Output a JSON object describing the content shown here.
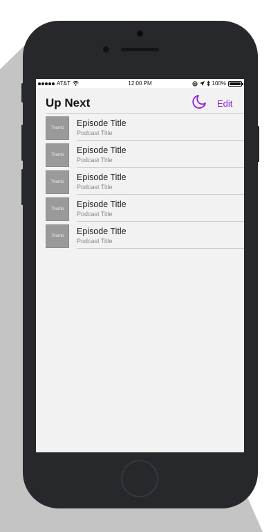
{
  "status_bar": {
    "carrier": "AT&T",
    "time": "12:00 PM",
    "battery": "100%"
  },
  "nav": {
    "title": "Up Next",
    "edit_label": "Edit",
    "accent_color": "#8a1fd8"
  },
  "episodes": [
    {
      "thumb": "Thumb",
      "title": "Episode Title",
      "podcast": "Podcast Title"
    },
    {
      "thumb": "Thumb",
      "title": "Episode Title",
      "podcast": "Podcast Title"
    },
    {
      "thumb": "Thumb",
      "title": "Episode Title",
      "podcast": "Podcast Title"
    },
    {
      "thumb": "Thumb",
      "title": "Episode Title",
      "podcast": "Podcast Title"
    },
    {
      "thumb": "Thumb",
      "title": "Episode Title",
      "podcast": "Podcast Title"
    }
  ],
  "icons": {
    "night_mode": "moon-icon",
    "wifi": "wifi-icon",
    "location": "location-arrow-icon",
    "bluetooth": "bluetooth-icon",
    "lock_rotation": "rotation-lock-icon"
  }
}
